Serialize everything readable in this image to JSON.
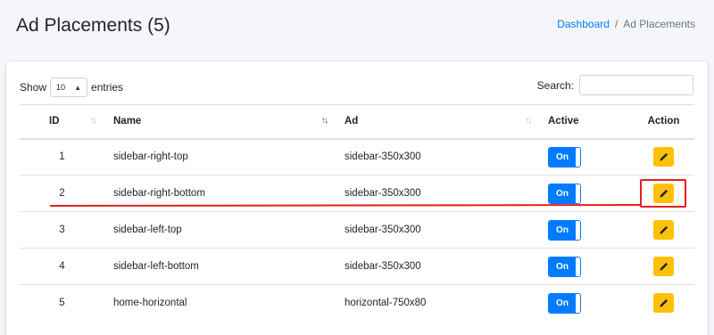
{
  "header": {
    "title": "Ad Placements (5)",
    "breadcrumb": {
      "link": "Dashboard",
      "separator": "/",
      "current": "Ad Placements"
    }
  },
  "table_controls": {
    "show_label": "Show",
    "entries_value": "10",
    "entries_label": "entries",
    "search_label": "Search:",
    "search_value": ""
  },
  "table": {
    "columns": [
      "ID",
      "Name",
      "Ad",
      "Active",
      "Action"
    ],
    "rows": [
      {
        "id": "1",
        "name": "sidebar-right-top",
        "ad": "sidebar-350x300",
        "active": "On"
      },
      {
        "id": "2",
        "name": "sidebar-right-bottom",
        "ad": "sidebar-350x300",
        "active": "On"
      },
      {
        "id": "3",
        "name": "sidebar-left-top",
        "ad": "sidebar-350x300",
        "active": "On"
      },
      {
        "id": "4",
        "name": "sidebar-left-bottom",
        "ad": "sidebar-350x300",
        "active": "On"
      },
      {
        "id": "5",
        "name": "home-horizontal",
        "ad": "horizontal-750x80",
        "active": "On"
      }
    ]
  },
  "colors": {
    "primary": "#007bff",
    "warning": "#ffc107",
    "annotation": "#e51f1f",
    "background": "#f4f6f9"
  },
  "icons": {
    "edit": "pencil-icon",
    "sort": "sort-arrows-icon",
    "select_caret": "updown-caret-icon"
  }
}
